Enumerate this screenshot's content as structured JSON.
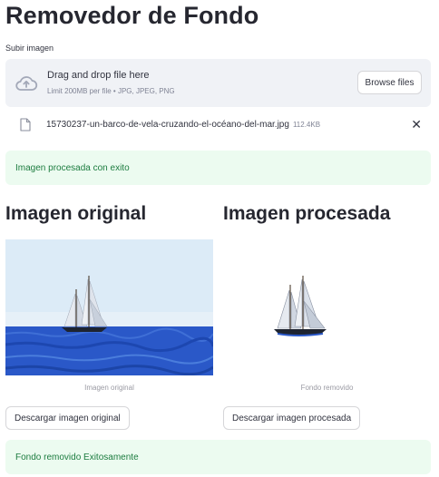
{
  "page": {
    "title": "Removedor de Fondo"
  },
  "uploader": {
    "label": "Subir imagen",
    "drop_text": "Drag and drop file here",
    "limit_text": "Limit 200MB per file • JPG, JPEG, PNG",
    "browse_label": "Browse files",
    "icon": "cloud-upload-icon"
  },
  "file": {
    "name": "15730237-un-barco-de-vela-cruzando-el-océano-del-mar.jpg",
    "size": "112.4KB",
    "icon": "file-icon",
    "remove_symbol": "✕"
  },
  "alerts": {
    "processed": "Imagen procesada con exito",
    "removed": "Fondo removido Exitosamente"
  },
  "left_column": {
    "heading": "Imagen original",
    "caption": "Imagen original",
    "download_label": "Descargar imagen original"
  },
  "right_column": {
    "heading": "Imagen procesada",
    "caption": "Fondo removido",
    "download_label": "Descargar imagen procesada"
  },
  "colors": {
    "success_bg": "#ecfbf0",
    "success_text": "#1c7c3f",
    "dropzone_bg": "#f0f2f6",
    "sea": "#2a56c6",
    "sky": "#dbeaf6"
  }
}
